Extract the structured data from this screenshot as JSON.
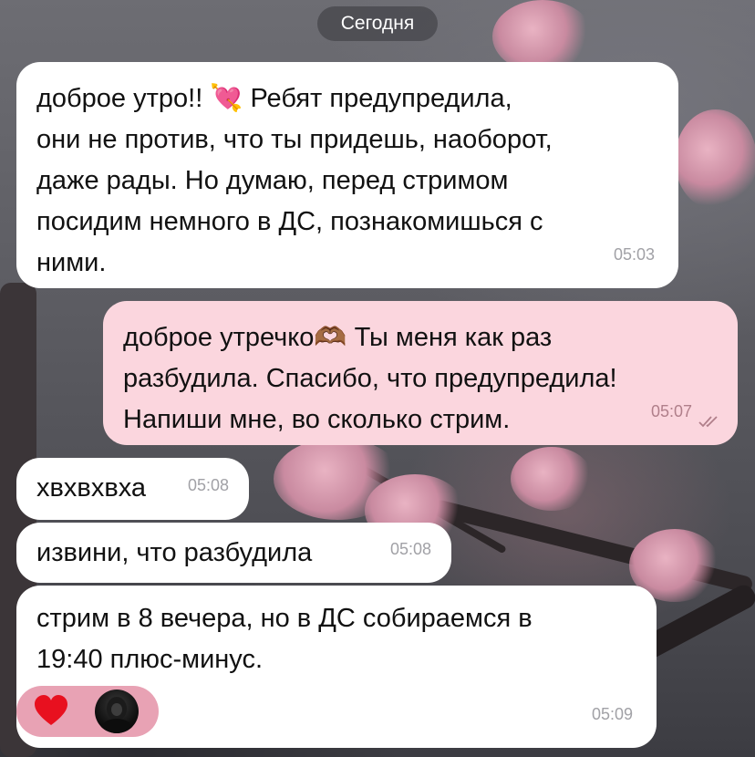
{
  "date_label": "Сегодня",
  "messages": [
    {
      "text": "доброе утро!! 💘 Ребят предупредила,\nони не против, что ты придешь, наоборот,\nдаже рады. Но думаю, перед стримом\nпосидим немного в ДС, познакомишься с\nними.",
      "time": "05:03",
      "direction": "incoming"
    },
    {
      "text": "доброе утречко🫶🏾 Ты меня как раз\nразбудила. Спасибо, что предупредила!\nНапиши мне, во сколько стрим.",
      "time": "05:07",
      "direction": "outgoing",
      "status": "read"
    },
    {
      "text": "хвхвхвха",
      "time": "05:08",
      "direction": "incoming"
    },
    {
      "text": "извини, что разбудила",
      "time": "05:08",
      "direction": "incoming"
    },
    {
      "text": "стрим в 8 вечера, но в ДС собираемся в\n19:40 плюс-минус.",
      "time": "05:09",
      "direction": "incoming"
    }
  ],
  "reaction": {
    "emoji": "heart-icon",
    "color": "#e8a2b4"
  },
  "colors": {
    "incoming_bubble": "#ffffff",
    "outgoing_bubble": "#fbd6de",
    "timestamp": "#a1a1a6"
  }
}
